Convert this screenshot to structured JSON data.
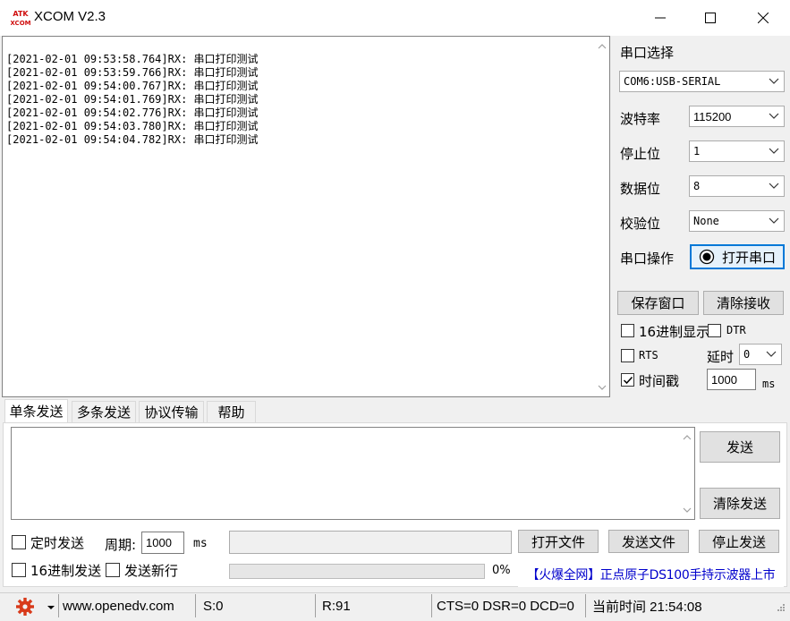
{
  "window": {
    "title": "XCOM V2.3",
    "logo_top": "ATK",
    "logo_bottom": "XCOM",
    "minimize_label": "—",
    "maximize_label": "☐",
    "close_label": "✕"
  },
  "receive": {
    "lines": [
      "[2021-02-01 09:53:58.764]RX: 串口打印测试",
      "[2021-02-01 09:53:59.766]RX: 串口打印测试",
      "[2021-02-01 09:54:00.767]RX: 串口打印测试",
      "[2021-02-01 09:54:01.769]RX: 串口打印测试",
      "[2021-02-01 09:54:02.776]RX: 串口打印测试",
      "[2021-02-01 09:54:03.780]RX: 串口打印测试",
      "[2021-02-01 09:54:04.782]RX: 串口打印测试"
    ]
  },
  "settings": {
    "port_select_label": "串口选择",
    "port_value": "COM6:USB-SERIAL",
    "baud_label": "波特率",
    "baud_value": "115200",
    "stop_bits_label": "停止位",
    "stop_bits_value": "1",
    "data_bits_label": "数据位",
    "data_bits_value": "8",
    "parity_label": "校验位",
    "parity_value": "None",
    "port_op_label": "串口操作",
    "open_port_button": "打开串口",
    "save_window_button": "保存窗口",
    "clear_receive_button": "清除接收",
    "hex_display_label": "16进制显示",
    "hex_display_checked": false,
    "dtr_label": "DTR",
    "dtr_checked": false,
    "rts_label": "RTS",
    "rts_checked": false,
    "delay_label": "延时",
    "delay_value": "0",
    "timestamp_label": "时间戳",
    "timestamp_checked": true,
    "timestamp_value": "1000",
    "timestamp_unit": "ms"
  },
  "tabs": [
    {
      "label": "单条发送",
      "active": true
    },
    {
      "label": "多条发送",
      "active": false
    },
    {
      "label": "协议传输",
      "active": false
    },
    {
      "label": "帮助",
      "active": false
    }
  ],
  "send": {
    "input_value": "",
    "send_button": "发送",
    "clear_send_button": "清除发送",
    "timed_send_label": "定时发送",
    "timed_send_checked": false,
    "period_label": "周期:",
    "period_value": "1000",
    "period_unit": "ms",
    "file_path_value": "",
    "open_file_button": "打开文件",
    "send_file_button": "发送文件",
    "stop_send_button": "停止发送",
    "hex_send_label": "16进制发送",
    "hex_send_checked": false,
    "newline_label": "发送新行",
    "newline_checked": false,
    "progress_percent": 0,
    "progress_text": "0%",
    "ad_text": "【火爆全网】正点原子DS100手持示波器上市"
  },
  "statusbar": {
    "website": "www.openedv.com",
    "sent": "S:0",
    "received": "R:91",
    "signals": "CTS=0 DSR=0 DCD=0",
    "time": "当前时间 21:54:08"
  },
  "colors": {
    "accent_border": "#0078d7",
    "ad_text": "#0000cc",
    "gear": "#d83a1a"
  }
}
